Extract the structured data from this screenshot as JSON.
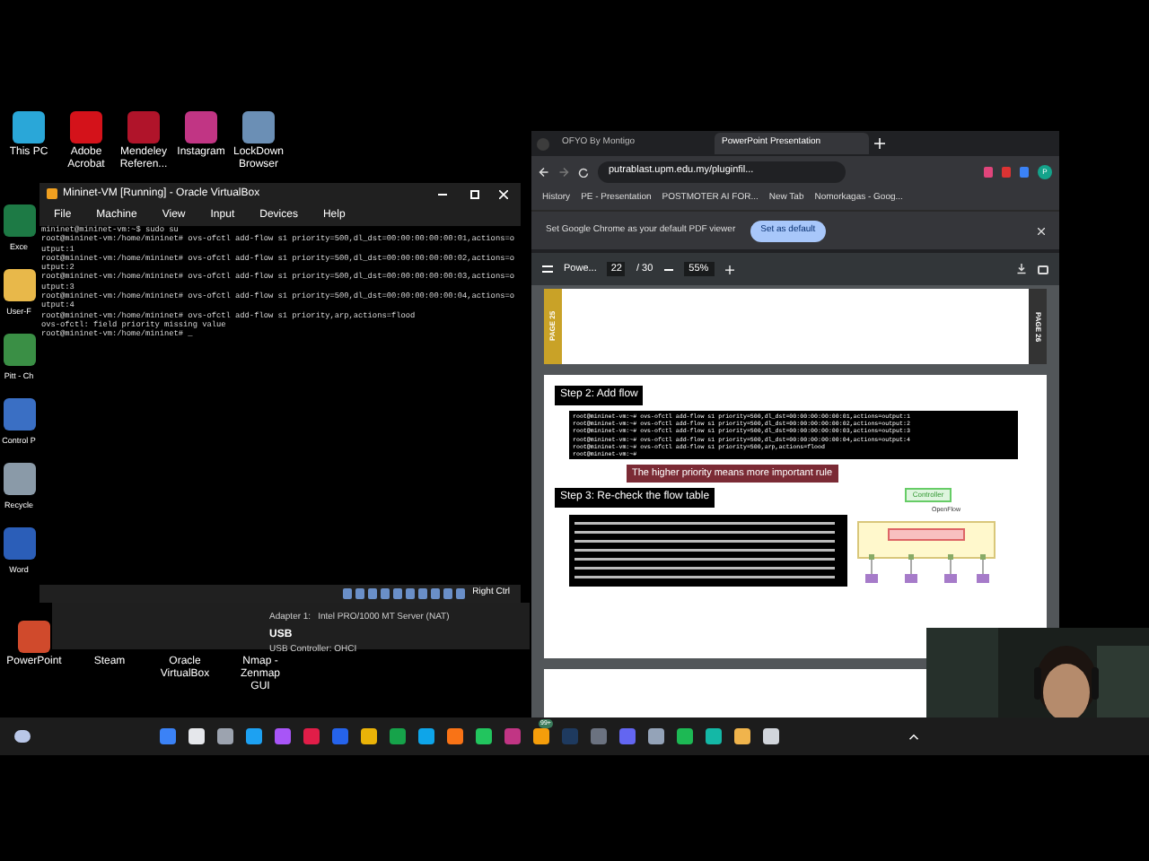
{
  "desktop_top": [
    {
      "label": "This PC",
      "kind": "monitor"
    },
    {
      "label": "Adobe Acrobat",
      "kind": "acrobat"
    },
    {
      "label": "Mendeley Referen...",
      "kind": "mendeley"
    },
    {
      "label": "Instagram",
      "kind": "instagram"
    },
    {
      "label": "LockDown Browser",
      "kind": "lockdown"
    }
  ],
  "desktop_left": [
    {
      "label": "Exce",
      "kind": "excel"
    },
    {
      "label": "User-F",
      "kind": "folder"
    },
    {
      "label": "Pitt - Ch",
      "kind": "chrome"
    },
    {
      "label": "Control P",
      "kind": "control"
    },
    {
      "label": "Recycle",
      "kind": "recycle"
    },
    {
      "label": "Word",
      "kind": "word"
    }
  ],
  "desktop_bottom": [
    {
      "label": "PowerPoint",
      "kind": "powerpoint"
    },
    {
      "label": "Steam"
    },
    {
      "label": "Oracle VirtualBox"
    },
    {
      "label": "Nmap - Zenmap GUI"
    }
  ],
  "vm_window": {
    "title": "Mininet-VM [Running] - Oracle VirtualBox",
    "menu": [
      "File",
      "Machine",
      "View",
      "Input",
      "Devices",
      "Help"
    ],
    "terminal_lines": [
      "mininet@mininet-vm:~$ sudo su",
      "root@mininet-vm:/home/mininet# ovs-ofctl add-flow s1 priority=500,dl_dst=00:00:00:00:00:01,actions=output:1",
      "root@mininet-vm:/home/mininet# ovs-ofctl add-flow s1 priority=500,dl_dst=00:00:00:00:00:02,actions=output:2",
      "root@mininet-vm:/home/mininet# ovs-ofctl add-flow s1 priority=500,dl_dst=00:00:00:00:00:03,actions=output:3",
      "root@mininet-vm:/home/mininet# ovs-ofctl add-flow s1 priority=500,dl_dst=00:00:00:00:00:04,actions=output:4",
      "root@mininet-vm:/home/mininet# ovs-ofctl add-flow s1 priority,arp,actions=flood",
      "ovs-ofctl: field priority missing value",
      "root@mininet-vm:/home/mininet# _"
    ],
    "host_key": "Right Ctrl"
  },
  "vbox_details": {
    "adapter_label": "Adapter 1:",
    "adapter_value": "Intel PRO/1000 MT Server (NAT)",
    "section": "USB",
    "cut_line": "USB Controller: OHCI"
  },
  "browser": {
    "tabs": [
      {
        "label": "OFYO By Montigo",
        "selected": false
      },
      {
        "label": "PowerPoint Presentation",
        "selected": true
      }
    ],
    "url": "putrablast.upm.edu.my/pluginfil...",
    "profile": "P",
    "bookmarks": [
      "History",
      "PE - Presentation",
      "POSTMOTER AI FOR...",
      "New Tab",
      "Nomorkagas - Goog..."
    ],
    "banner": {
      "text": "Set Google Chrome as your default PDF viewer",
      "button": "Set as default"
    },
    "pdf_toolbar": {
      "title": "Powe...",
      "page": "22",
      "total": "/ 30",
      "zoom": "55%"
    },
    "page_25": {
      "side_label": "PAGE 25",
      "next_label": "PAGE 26"
    },
    "slide": {
      "step2": "Step 2: Add flow",
      "commands": [
        "root@mininet-vm:~# ovs-ofctl add-flow s1 priority=500,dl_dst=00:00:00:00:00:01,actions=output:1",
        "root@mininet-vm:~# ovs-ofctl add-flow s1 priority=500,dl_dst=00:00:00:00:00:02,actions=output:2",
        "root@mininet-vm:~# ovs-ofctl add-flow s1 priority=500,dl_dst=00:00:00:00:00:03,actions=output:3",
        "root@mininet-vm:~# ovs-ofctl add-flow s1 priority=500,dl_dst=00:00:00:00:00:04,actions=output:4",
        "root@mininet-vm:~# ovs-ofctl add-flow s1 priority=500,arp,actions=flood",
        "root@mininet-vm:~#"
      ],
      "note": "The higher priority means more important rule",
      "step3": "Step 3: Re-check the flow table",
      "controller": "Controller",
      "openflow": "OpenFlow"
    }
  },
  "taskbar": {
    "badge": "99+"
  }
}
